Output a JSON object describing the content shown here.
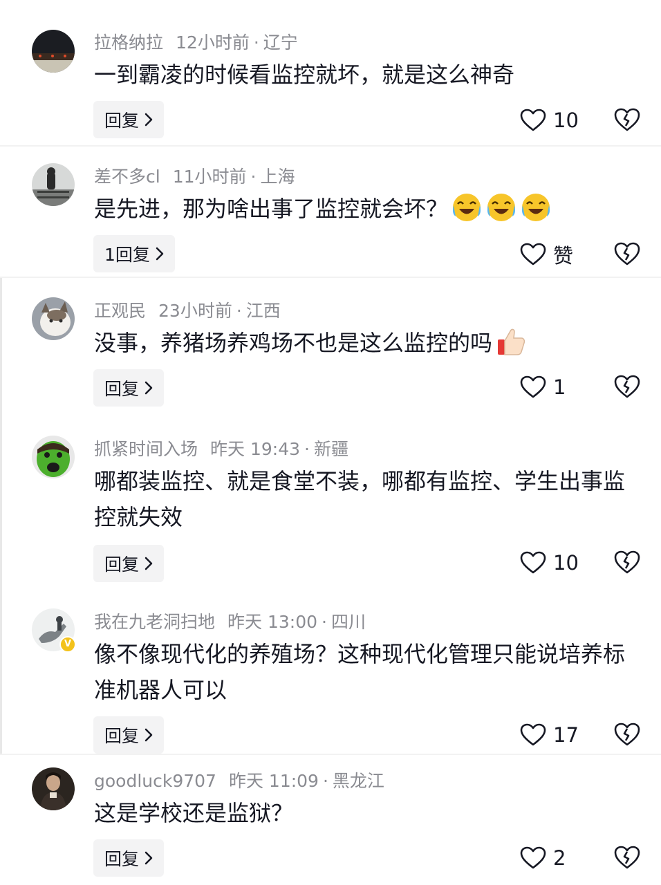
{
  "comments": [
    {
      "user": "拉格纳拉",
      "time": "12小时前",
      "location": "辽宁",
      "text": "一到霸凌的时候看监控就坏，就是这么神奇",
      "reply_label": "回复",
      "likes": "10",
      "emoji": ""
    },
    {
      "user": "差不多cl",
      "time": "11小时前",
      "location": "上海",
      "text": "是先进，那为啥出事了监控就会坏？",
      "reply_label": "1回复",
      "likes": "赞",
      "emoji": "laugh-cry-emoji"
    },
    {
      "user": "正观民",
      "time": "23小时前",
      "location": "江西",
      "text": "没事，养猪场养鸡场不也是这么监控的吗",
      "reply_label": "回复",
      "likes": "1",
      "emoji": "thumbs-up-emoji"
    },
    {
      "user": "抓紧时间入场",
      "time": "昨天 19:43",
      "location": "新疆",
      "text": "哪都装监控、就是食堂不装，哪都有监控、学生出事监控就失效",
      "reply_label": "回复",
      "likes": "10",
      "emoji": ""
    },
    {
      "user": "我在九老洞扫地",
      "time": "昨天 13:00",
      "location": "四川",
      "text": "像不像现代化的养殖场？这种现代化管理只能说培养标准机器人可以",
      "reply_label": "回复",
      "likes": "17",
      "emoji": "",
      "verified_badge": "V"
    },
    {
      "user": "goodluck9707",
      "time": "昨天 11:09",
      "location": "黑龙江",
      "text": "这是学校还是监狱？",
      "reply_label": "回复",
      "likes": "2",
      "emoji": ""
    }
  ],
  "separator": "·",
  "colors": {
    "meta": "#8a8b91",
    "text": "#161823",
    "button_bg": "#f3f3f4"
  }
}
